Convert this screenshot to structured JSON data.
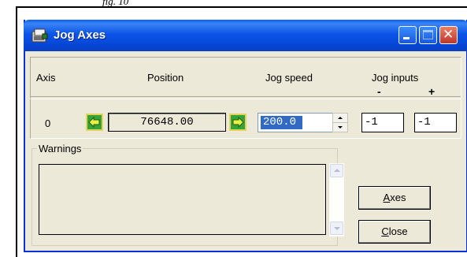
{
  "caption": "fig. 10",
  "window": {
    "title": "Jog Axes",
    "colors": {
      "titlebar": "#0A5FF1",
      "close": "#D64F3A",
      "face": "#ECE9D8",
      "selection": "#316AC5"
    }
  },
  "headers": {
    "axis": "Axis",
    "position": "Position",
    "jog_speed": "Jog speed",
    "jog_inputs": "Jog inputs",
    "minus": "-",
    "plus": "+"
  },
  "row": {
    "axis": "0",
    "position": "76648.00",
    "jog_speed": "200.0",
    "jog_minus": "-1",
    "jog_plus": "-1"
  },
  "icons": {
    "jog_left": "left-arrow-icon",
    "jog_right": "right-arrow-icon",
    "app": "window-app-icon"
  },
  "warnings": {
    "label": "Warnings",
    "text": ""
  },
  "buttons": {
    "axes": {
      "first": "A",
      "rest": "xes"
    },
    "close": {
      "first": "C",
      "rest": "lose"
    }
  }
}
